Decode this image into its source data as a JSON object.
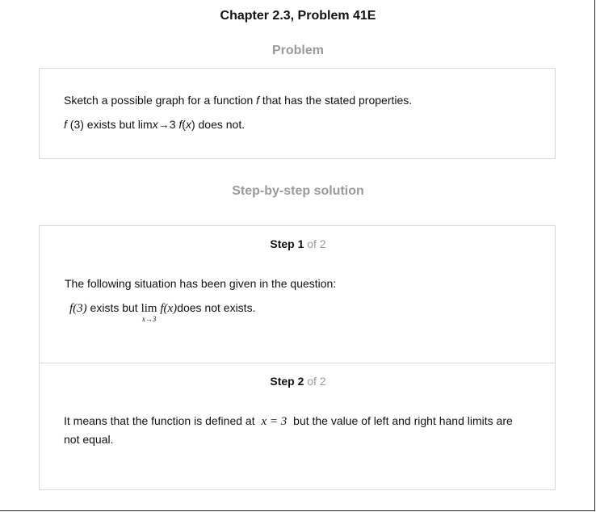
{
  "header": {
    "chapter_title": "Chapter 2.3, Problem 41E"
  },
  "problem": {
    "section_label": "Problem",
    "line1_pre": "Sketch a possible graph for a function ",
    "line1_var": "f",
    "line1_post": " that has the stated properties.",
    "line2_f": "f",
    "line2_mid": " (3) exists but lim",
    "line2_x": "x",
    "line2_arrow": "→3 ",
    "line2_f2": "f",
    "line2_open": "(",
    "line2_x2": "x",
    "line2_tail": ") does not."
  },
  "solution": {
    "section_label": "Step-by-step solution",
    "step1": {
      "label": "Step 1",
      "of": " of 2",
      "intro": "The following situation has been given in the question:",
      "math_f3": "f(3)",
      "text_mid": " exists but ",
      "lim": "lim",
      "lim_sub": "x→3",
      "lim_fx": " f(x)",
      "text_end": "does not exists."
    },
    "step2": {
      "label": "Step 2",
      "of": " of 2",
      "line1_pre": "It means that the function is defined at ",
      "math_x": "x = 3",
      "line1_post": " but the value of left and right hand limits are",
      "line2": "not equal."
    }
  }
}
